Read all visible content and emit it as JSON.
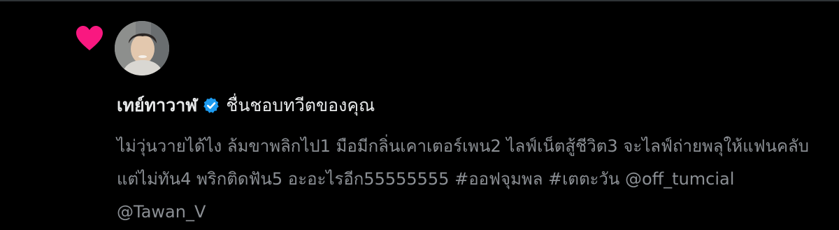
{
  "notification": {
    "type_icon": "heart-icon",
    "type_color": "#f91880",
    "avatar_icon": "user-avatar",
    "user_name": "เทย์ทาวาฬ",
    "verified_icon": "verified-badge-icon",
    "verified_color": "#1d9bf0",
    "action_text": "ชื่นชอบทวีตของคุณ",
    "tweet_text": "ไม่วุ่นวายได้ไง ล้มขาพลิกไป1 มือมีกลิ่นเคาเตอร์เพน2 ไลฟ์เน็ตสู้ชีวิต3 จะไลฟ์ถ่ายพลุให้แฟนคลับแต่ไม่ทัน4 พริกติดฟัน5 อะอะไรอีก55555555 #ออฟจุมพล #เตตะวัน @off_tumcial @Tawan_V"
  }
}
